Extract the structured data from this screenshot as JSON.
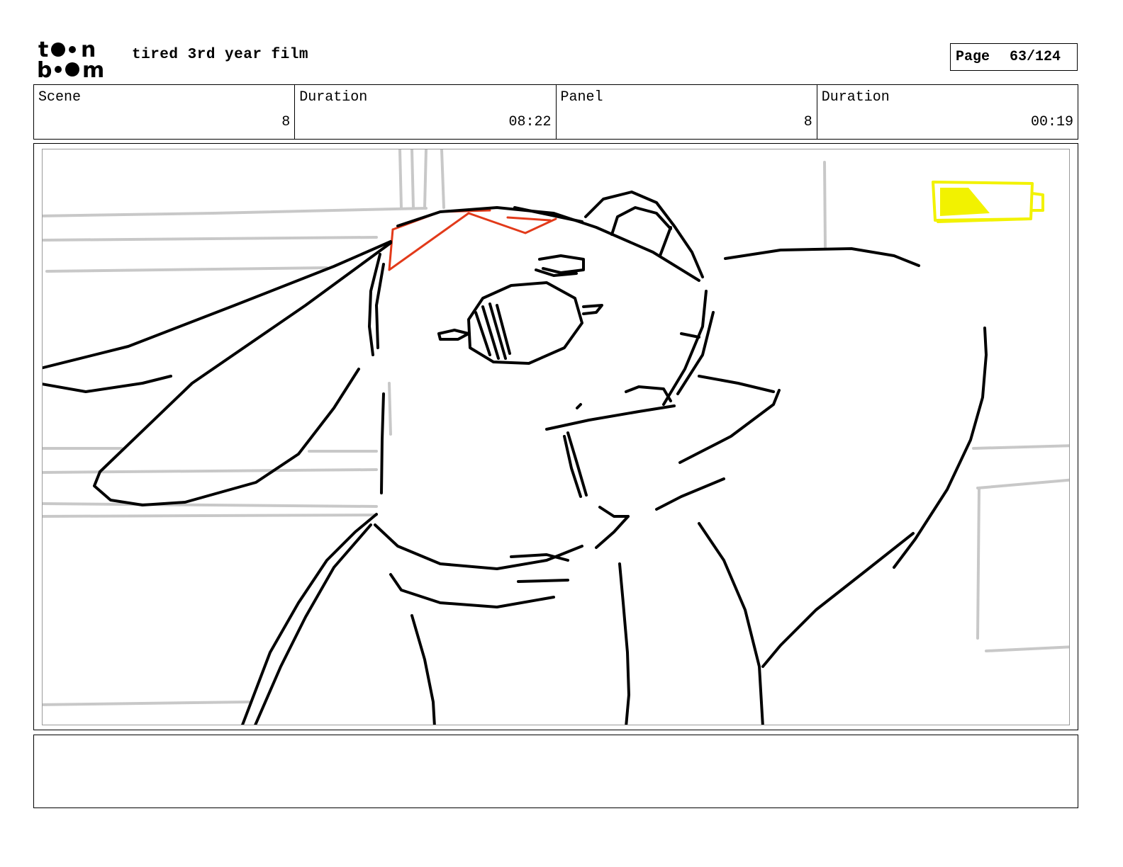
{
  "header": {
    "project_title": "tired 3rd year film",
    "page_label": "Page",
    "page_value": "63/124"
  },
  "info": {
    "scene_label": "Scene",
    "scene_value": "8",
    "scene_duration_label": "Duration",
    "scene_duration_value": "08:22",
    "panel_label": "Panel",
    "panel_value": "8",
    "panel_duration_label": "Duration",
    "panel_duration_value": "00:19"
  },
  "notes": {
    "text": ""
  },
  "colors": {
    "ink": "#000000",
    "background_sketch": "#c8c8c8",
    "accent_red": "#e23a1a",
    "battery_yellow": "#f2f200"
  }
}
